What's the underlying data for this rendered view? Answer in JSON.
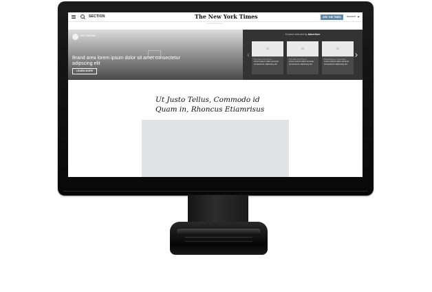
{
  "nav": {
    "section_label": "SECTION",
    "masthead": "The New York Times",
    "subscribe_label": "SEE THE TIMES",
    "account_label": "Account"
  },
  "brand": {
    "logo_text": "THE COMPANY",
    "text": "Brand area lorem ipsum dolor sit amet consectetur adipscing elit",
    "cta_label": "LEARN MORE"
  },
  "advertiser": {
    "title_prefix": "Content selected by",
    "title_name": "Advertiser",
    "cards": [
      {
        "source": "The New York Times",
        "text": "Lorem ipsum dolor sit amet consectetur adipscing elit"
      },
      {
        "source": "The New York Times",
        "text": "Lorem ipsum dolor sit amet consectetur adipscing elit"
      },
      {
        "source": "Brand/Agency: Advertiser",
        "text": "Lorem ipsum dolor sit amet consectetur adipscing elit"
      }
    ]
  },
  "article": {
    "headline": "Ut Justo Tellus, Commodo id Quam in, Rhoncus Etiamrisus"
  },
  "colors": {
    "subscribe_bg": "#6288a5",
    "advertiser_bg": "#333333",
    "image_placeholder": "#e1e2e4"
  }
}
